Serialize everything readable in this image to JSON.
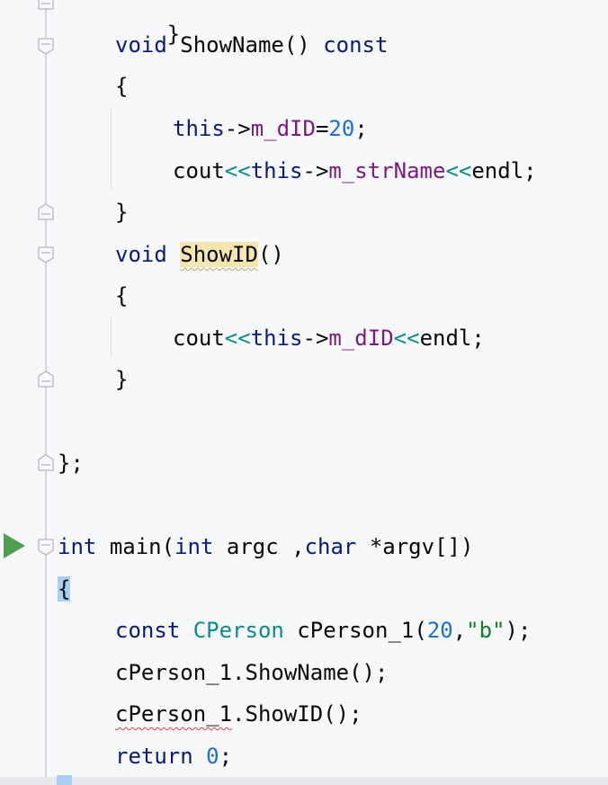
{
  "code": {
    "line0": {
      "brace": "}"
    },
    "line1": {
      "kw_void": "void",
      "fn": "ShowName",
      "parens": "()",
      "kw_const": "const"
    },
    "line2": {
      "brace": "{"
    },
    "line3": {
      "kw_this": "this",
      "arrow": "->",
      "member": "m_dID",
      "eq": "=",
      "num": "20",
      "semi": ";"
    },
    "line4": {
      "cout": "cout",
      "op1": "<<",
      "kw_this": "this",
      "arrow": "->",
      "member": "m_strName",
      "op2": "<<",
      "endl": "endl",
      "semi": ";"
    },
    "line5": {
      "brace": "}"
    },
    "line6": {
      "kw_void": "void",
      "fn": "ShowID",
      "parens": "()"
    },
    "line7": {
      "brace": "{"
    },
    "line8": {
      "cout": "cout",
      "op1": "<<",
      "kw_this": "this",
      "arrow": "->",
      "member": "m_dID",
      "op2": "<<",
      "endl": "endl",
      "semi": ";"
    },
    "line9": {
      "brace": "}"
    },
    "line11": {
      "text": "};"
    },
    "line13": {
      "kw_int": "int",
      "fn": "main(",
      "kw_int2": "int",
      "arg1": " argc ,",
      "kw_char": "char",
      "arg2": " *argv[])"
    },
    "line14": {
      "brace": "{"
    },
    "line15": {
      "kw_const": "const",
      "type": "CPerson",
      "rest1": " cPerson_1(",
      "num": "20",
      "comma": ",",
      "str": "\"b\"",
      "rest2": ");"
    },
    "line16": {
      "text": "cPerson_1.ShowName();"
    },
    "line17": {
      "obj": "cPerson_1",
      "rest": ".ShowID();"
    },
    "line18": {
      "kw_return": "return",
      "num": "0",
      "semi": ";"
    }
  },
  "colors": {
    "keyword": "#0a1a78",
    "teal": "#0e8a8a",
    "member": "#7a1a7f",
    "number": "#1a70d8",
    "string": "#167d2c",
    "run": "#4ea04e"
  },
  "icons": {
    "run": "run-gutter-icon",
    "fold": "fold-marker-icon"
  }
}
